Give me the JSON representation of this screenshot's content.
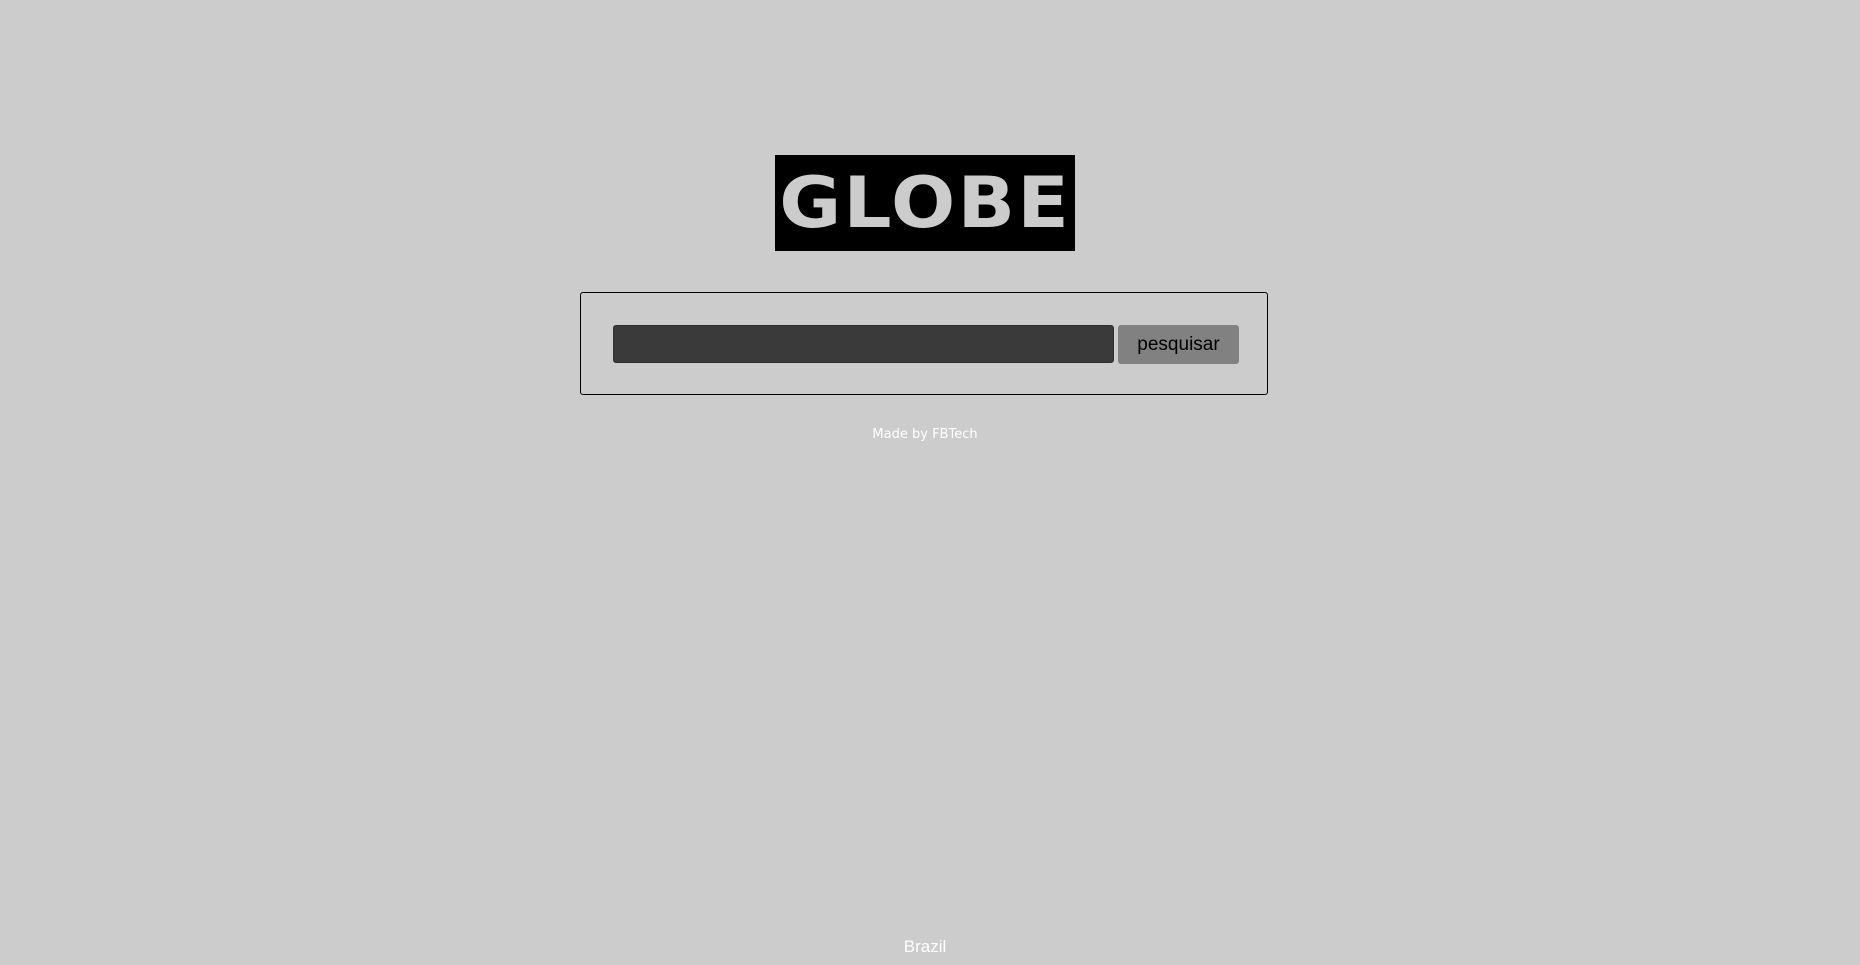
{
  "logo": {
    "text": "GLOBE"
  },
  "search": {
    "value": "",
    "placeholder": "",
    "button_label": "pesquisar"
  },
  "footer": {
    "made_by": "Made by FBTech",
    "country": "Brazil"
  },
  "colors": {
    "background": "#cccccc",
    "logo_background": "#000000",
    "input_background": "#3a3a3a",
    "button_background": "#818181",
    "footer_text": "#ffffff"
  }
}
